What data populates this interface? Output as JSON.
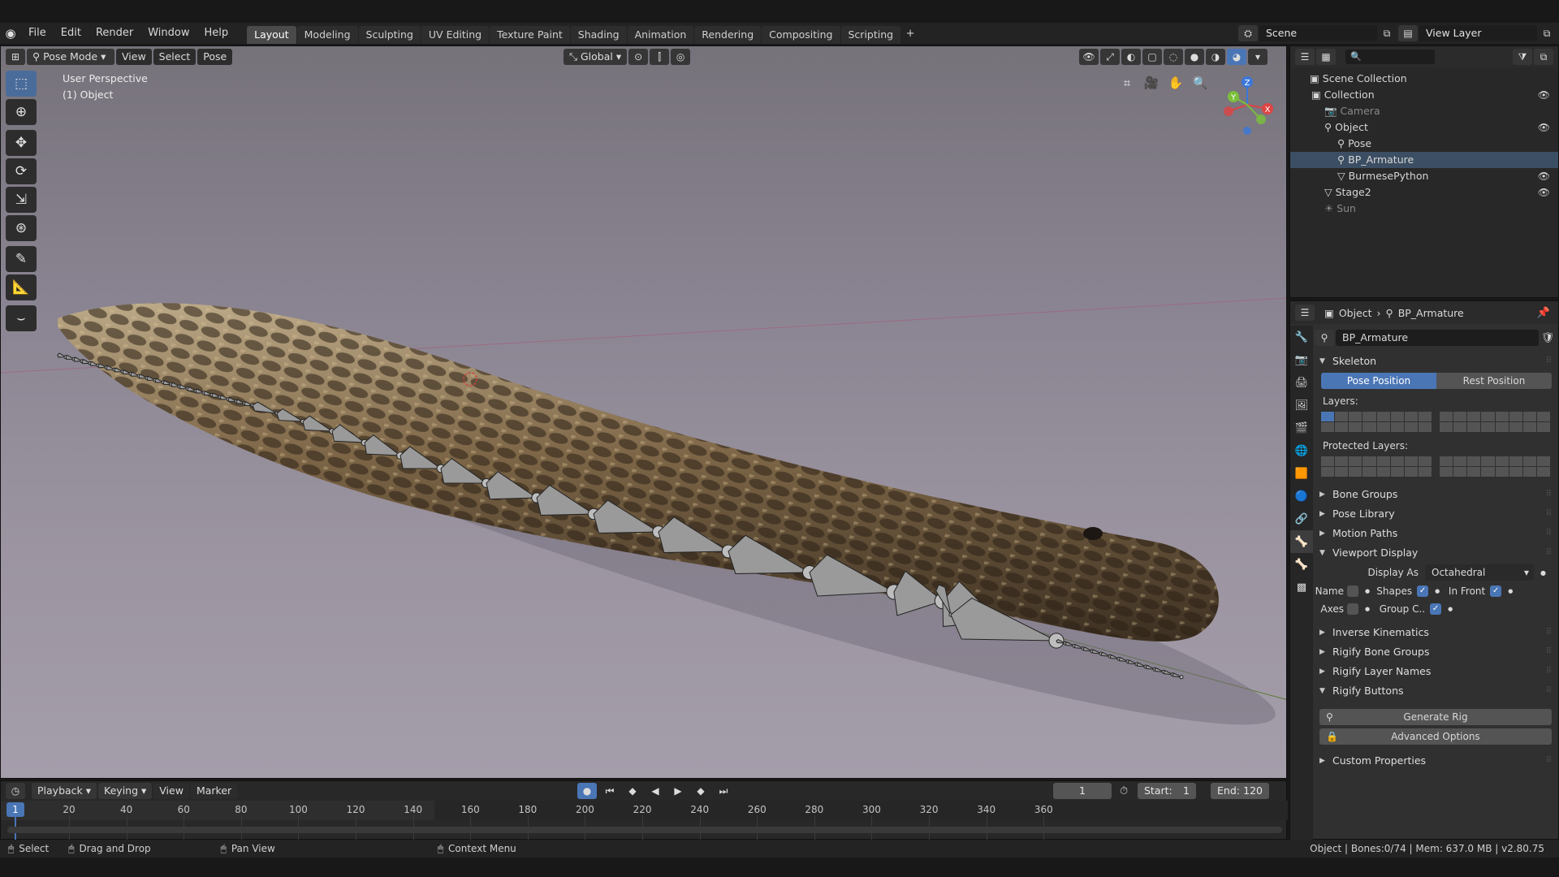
{
  "topbar": {
    "menus": [
      "File",
      "Edit",
      "Render",
      "Window",
      "Help"
    ],
    "workspaces": [
      "Layout",
      "Modeling",
      "Sculpting",
      "UV Editing",
      "Texture Paint",
      "Shading",
      "Animation",
      "Rendering",
      "Compositing",
      "Scripting"
    ],
    "active_workspace": "Layout",
    "add_tab": "+",
    "scene": "Scene",
    "view_layer": "View Layer"
  },
  "viewport": {
    "mode": "Pose Mode",
    "menus": [
      "View",
      "Select",
      "Pose"
    ],
    "orientation": "Global",
    "overlay_title": "User Perspective",
    "overlay_object": "(1) Object",
    "gizmo": {
      "x": "X",
      "y": "Y",
      "z": "Z"
    }
  },
  "outliner": {
    "root": "Scene Collection",
    "rows": [
      {
        "label": "Collection",
        "level": 1,
        "dim": false,
        "selected": false,
        "eye": true
      },
      {
        "label": "Camera",
        "level": 2,
        "dim": true,
        "selected": false,
        "eye": false
      },
      {
        "label": "Object",
        "level": 2,
        "dim": false,
        "selected": false,
        "eye": true
      },
      {
        "label": "Pose",
        "level": 3,
        "dim": false,
        "selected": false,
        "eye": false
      },
      {
        "label": "BP_Armature",
        "level": 3,
        "dim": false,
        "selected": true,
        "eye": false
      },
      {
        "label": "BurmesePython",
        "level": 3,
        "dim": false,
        "selected": false,
        "eye": true
      },
      {
        "label": "Stage2",
        "level": 2,
        "dim": false,
        "selected": false,
        "eye": true
      },
      {
        "label": "Sun",
        "level": 2,
        "dim": true,
        "selected": false,
        "eye": false
      }
    ]
  },
  "properties": {
    "breadcrumb_object": "Object",
    "breadcrumb_data": "BP_Armature",
    "datablock_name": "BP_Armature",
    "skeleton": {
      "title": "Skeleton",
      "pose_position": "Pose Position",
      "rest_position": "Rest Position",
      "layers_label": "Layers:",
      "protected_label": "Protected Layers:"
    },
    "collapsed_panels": [
      "Bone Groups",
      "Pose Library",
      "Motion Paths"
    ],
    "viewport_display": {
      "title": "Viewport Display",
      "display_as_label": "Display As",
      "display_as_value": "Octahedral",
      "name": "Name",
      "shapes": "Shapes",
      "in_front": "In Front",
      "axes": "Axes",
      "group_colors": "Group C.."
    },
    "more_panels": [
      "Inverse Kinematics",
      "Rigify Bone Groups",
      "Rigify Layer Names"
    ],
    "rigify_buttons": {
      "title": "Rigify Buttons",
      "generate": "Generate Rig",
      "advanced": "Advanced Options"
    },
    "custom_properties": "Custom Properties"
  },
  "timeline": {
    "menus": [
      "Playback",
      "Keying",
      "View",
      "Marker"
    ],
    "current_frame": "1",
    "start_label": "Start:",
    "start": "1",
    "end_label": "End:",
    "end": "120",
    "ticks": [
      "20",
      "40",
      "60",
      "80",
      "100",
      "120",
      "140",
      "160",
      "180",
      "200",
      "220",
      "240",
      "260",
      "280",
      "300",
      "320",
      "340",
      "360"
    ],
    "playhead": "1"
  },
  "statusbar": {
    "select": "Select",
    "drag": "Drag and Drop",
    "pan": "Pan View",
    "context": "Context Menu",
    "info": "Object | Bones:0/74 | Mem: 637.0 MB | v2.80.75"
  },
  "colors": {
    "accent": "#4a76b6",
    "selected_row": "#3c4e63",
    "panel_bg": "#303030",
    "header_bg": "#232323"
  }
}
